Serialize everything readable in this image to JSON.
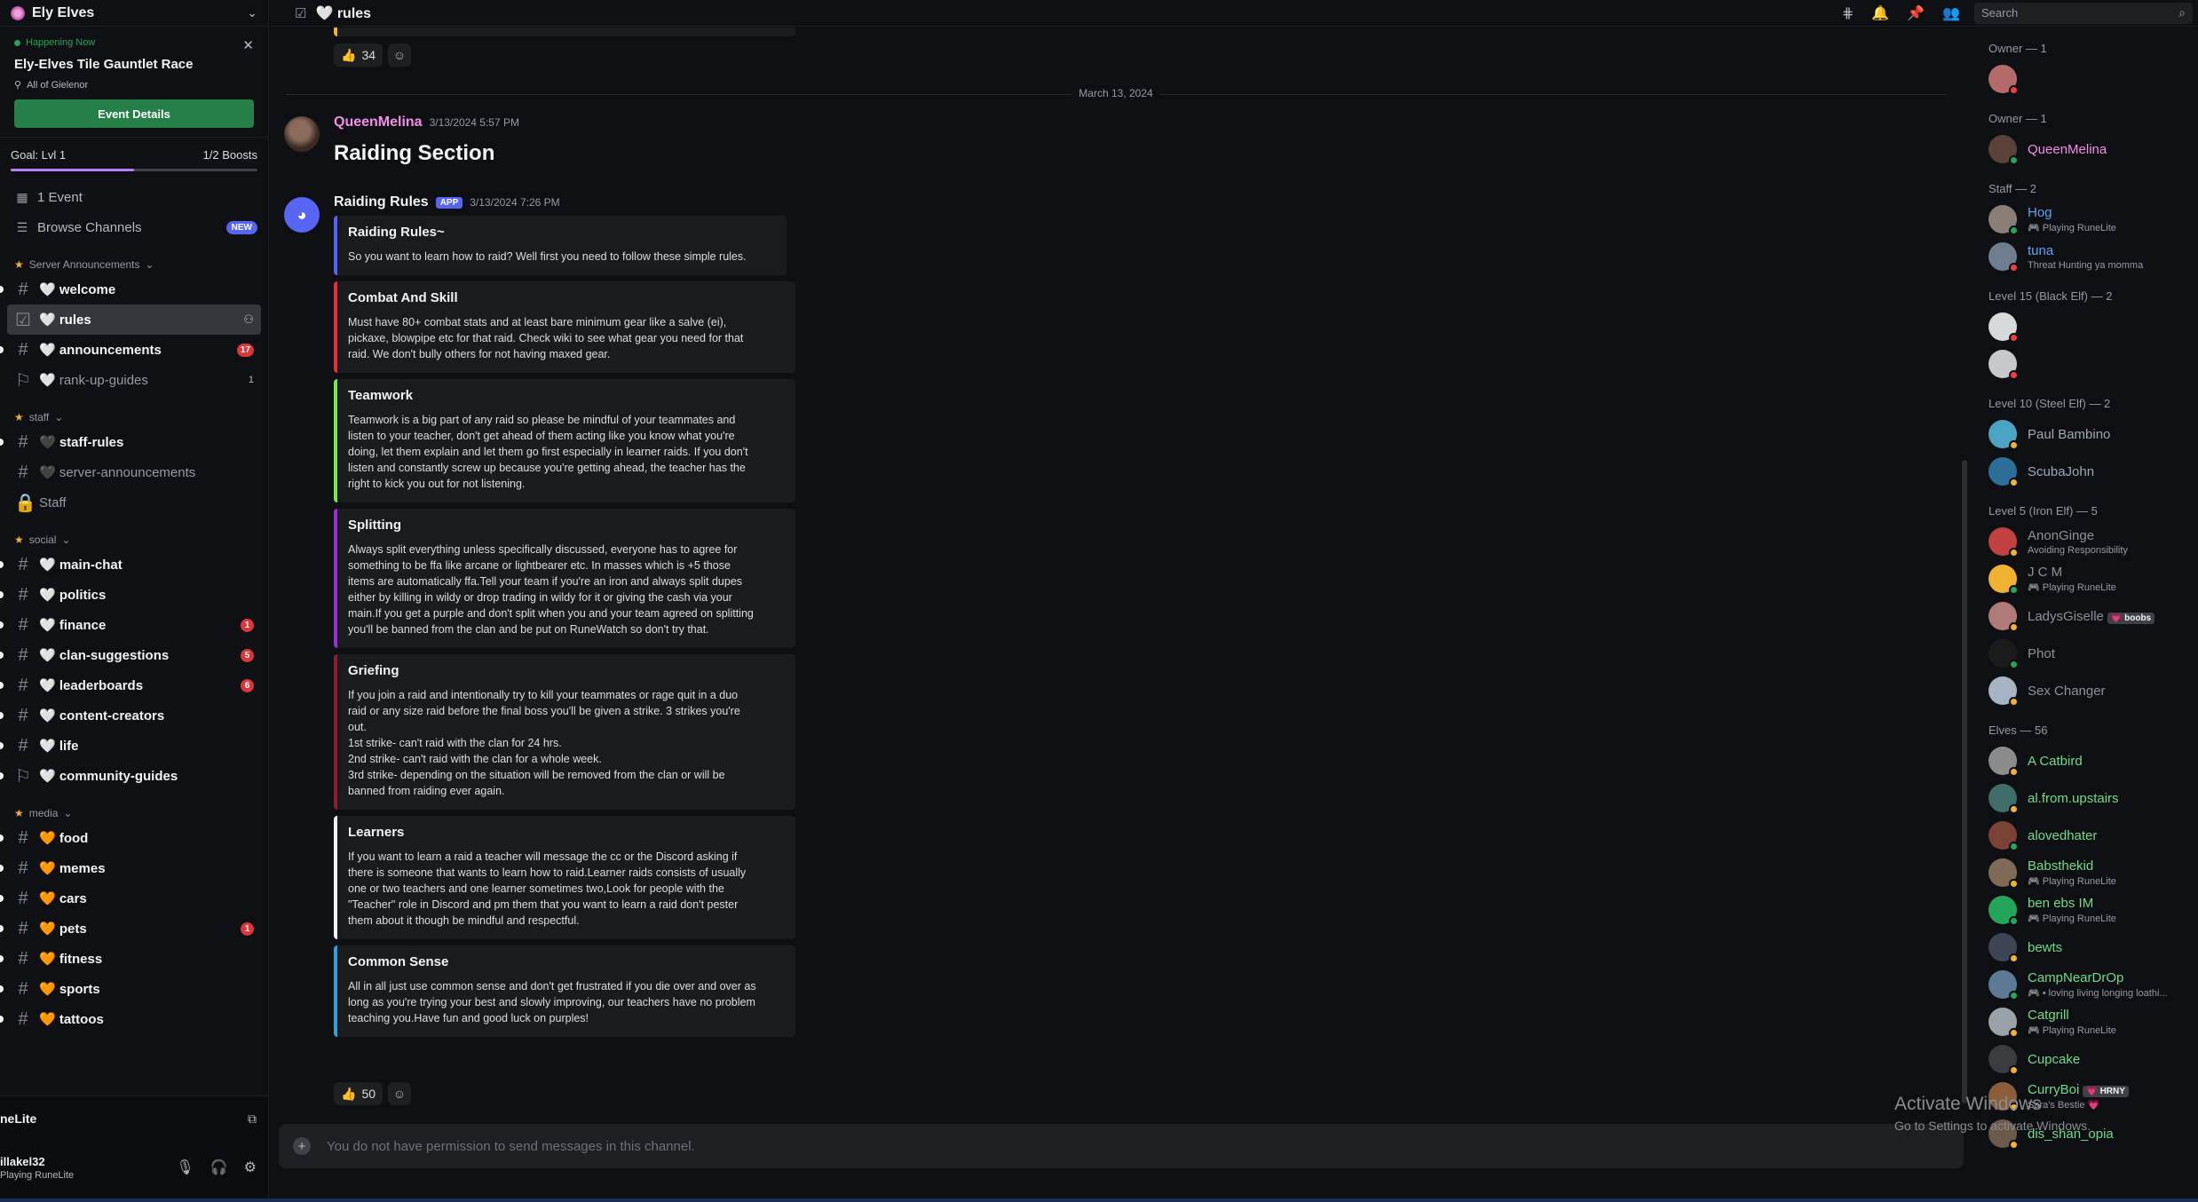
{
  "server": {
    "name": "Ely Elves"
  },
  "event": {
    "status": "Happening Now",
    "title": "Ely-Elves Tile Gauntlet Race",
    "location": "All of Gielenor",
    "button": "Event Details"
  },
  "boost": {
    "goal": "Goal: Lvl 1",
    "progress": "1/2 Boosts",
    "fill_fraction": 0.5
  },
  "nav": {
    "events": "1 Event",
    "browse": "Browse Channels",
    "browse_badge": "NEW"
  },
  "categories": {
    "announcements": "Server Announcements",
    "staff": "staff",
    "social": "social",
    "media": "media"
  },
  "channels": {
    "welcome": "🤍 welcome",
    "rules": "🤍 rules",
    "announcements": "🤍 announcements",
    "announcements_badge": "17",
    "rank_up": "🤍 rank-up-guides",
    "rank_up_count": "1",
    "staff_rules": "🖤 staff-rules",
    "server_ann": "🖤 server-announcements",
    "staff": "Staff",
    "main_chat": "🤍 main-chat",
    "politics": "🤍 politics",
    "finance": "🤍 finance",
    "finance_badge": "1",
    "clan_suggestions": "🤍 clan-suggestions",
    "clan_suggestions_badge": "5",
    "leaderboards": "🤍 leaderboards",
    "leaderboards_badge": "6",
    "content_creators": "🤍 content-creators",
    "life": "🤍 life",
    "community_guides": "🤍 community-guides",
    "food": "🧡 food",
    "memes": "🧡 memes",
    "cars": "🧡 cars",
    "pets": "🧡 pets",
    "pets_badge": "1",
    "fitness": "🧡 fitness",
    "sports": "🧡 sports",
    "tattoos": "🧡 tattoos"
  },
  "user_panel": {
    "activity": "neLite",
    "username": "illakel32",
    "status": "Playing RuneLite"
  },
  "topbar": {
    "channel": "🤍 rules",
    "search_placeholder": "Search"
  },
  "messages": {
    "top_reaction_count": "34",
    "date_divider": "March 13, 2024",
    "msg1": {
      "author": "QueenMelina",
      "time": "3/13/2024 5:57 PM",
      "heading": "Raiding Section"
    },
    "msg2": {
      "author": "Raiding Rules",
      "app_tag": "APP",
      "time": "3/13/2024 7:26 PM",
      "reaction_count": "50"
    }
  },
  "embeds": [
    {
      "title": "Raiding Rules~",
      "color": "#5865f2",
      "desc": "So you want to learn how to raid? Well first you need to follow these simple rules."
    },
    {
      "title": "Combat And Skill",
      "color": "#ed2c3a",
      "desc": "Must have 80+ combat stats and at least bare minimum gear like a salve (ei),\npickaxe, blowpipe etc for that raid. Check wiki to see what gear you need for that\nraid. We don't bully others for not having maxed gear."
    },
    {
      "title": "Teamwork",
      "color": "#7ee84a",
      "desc": "Teamwork is a big part of any raid so please be mindful of your teammates and\nlisten to your teacher, don't get ahead of them acting like you know what you're\ndoing, let them explain and let them go first especially in learner raids. If you don't\nlisten and constantly screw up because you're getting ahead, the teacher has the\nright to kick you out for not listening."
    },
    {
      "title": "Splitting",
      "color": "#9b2fd6",
      "desc": "Always split everything unless specifically discussed, everyone has to agree for\nsomething to be ffa like arcane or lightbearer etc. In masses which is +5 those\nitems are automatically ffa.Tell your team if you're an iron and always split dupes\neither by killing in wildy or drop trading in wildy for it or giving the cash via your\nmain.If you get a purple and don't split when you and your team agreed on splitting\nyou'll be banned from the clan and be put on RuneWatch so don't try that."
    },
    {
      "title": "Griefing",
      "color": "#8c1d2c",
      "desc": "If you join a raid and intentionally try to kill your teammates or rage quit in a duo\nraid or any size raid before the final boss you'll be given a strike. 3 strikes you're\nout.\n1st strike- can't raid with the clan for 24 hrs.\n2nd strike- can't raid with the clan for a whole week.\n3rd strike- depending on the situation will be removed from the clan or will be\nbanned from raiding ever again."
    },
    {
      "title": "Learners",
      "color": "#f2f3f5",
      "desc": "If you want to learn a raid a teacher will message the cc or the Discord asking if\nthere is someone that wants to learn how to raid.Learner raids consists of usually\none or two teachers and one learner sometimes two,Look for people with the\n\"Teacher\" role in Discord and pm them that you want to learn a raid don't pester\nthem about it though be mindful and respectful."
    },
    {
      "title": "Common Sense",
      "color": "#2aa3d9",
      "desc": "All in all just use common sense and don't get frustrated if you die over and over as\nlong as you're trying your best and slowly improving, our teachers have no problem\nteaching you.Have fun and good luck on purples!"
    }
  ],
  "composer": {
    "placeholder": "You do not have permission to send messages in this channel."
  },
  "member_groups": [
    {
      "label": "Owner — 1",
      "members": [
        {
          "name": "",
          "sub": "",
          "color": "#ffffff",
          "status": "dnd",
          "av": "#b56a6a"
        }
      ]
    },
    {
      "label": "Owner — 1",
      "members": [
        {
          "name": "QueenMelina",
          "sub": "",
          "color": "#f28fe6",
          "status": "online",
          "av": "#5a4238"
        }
      ]
    },
    {
      "label": "Staff — 2",
      "members": [
        {
          "name": "Hog",
          "sub": "🎮 Playing RuneLite",
          "color": "#5da3f5",
          "status": "online",
          "av": "#8a7e77"
        },
        {
          "name": "tuna",
          "sub": "Threat Hunting ya momma",
          "color": "#5da3f5",
          "status": "dnd",
          "av": "#6d7e8f"
        }
      ]
    },
    {
      "label": "Level 15 (Black Elf) — 2",
      "members": [
        {
          "name": "",
          "sub": "",
          "color": "#ffffff",
          "status": "dnd",
          "av": "#d8d9dc"
        },
        {
          "name": "",
          "sub": "",
          "color": "#ffffff",
          "status": "dnd",
          "av": "#c7c8cc"
        }
      ]
    },
    {
      "label": "Level 10 (Steel Elf) — 2",
      "members": [
        {
          "name": "Paul Bambino",
          "sub": "",
          "color": "#9ea9b3",
          "status": "idle",
          "av": "#4da3c2"
        },
        {
          "name": "ScubaJohn",
          "sub": "",
          "color": "#9ea9b3",
          "status": "idle",
          "av": "#2b6f98"
        }
      ]
    },
    {
      "label": "Level 5 (Iron Elf) — 5",
      "members": [
        {
          "name": "AnonGinge",
          "sub": "Avoiding Responsibility",
          "color": "#8e9297",
          "status": "idle",
          "av": "#c14040"
        },
        {
          "name": "J C M",
          "sub": "🎮 Playing RuneLite",
          "color": "#8e9297",
          "status": "online",
          "av": "#f0b232"
        },
        {
          "name": "LadysGiselle",
          "sub": "",
          "color": "#8e9297",
          "status": "idle",
          "av": "#b07a78",
          "tag": "💗 boobs"
        },
        {
          "name": "Phot",
          "sub": "",
          "color": "#8e9297",
          "status": "online",
          "av": "#1b1b1b"
        },
        {
          "name": "Sex Changer",
          "sub": "",
          "color": "#8e9297",
          "status": "idle",
          "av": "#a7b4c4"
        }
      ]
    },
    {
      "label": "Elves — 56",
      "members": [
        {
          "name": "A Catbird",
          "sub": "",
          "color": "#6fdc8c",
          "status": "idle",
          "av": "#8b8b8b"
        },
        {
          "name": "al.from.upstairs",
          "sub": "",
          "color": "#6fdc8c",
          "status": "idle",
          "av": "#3f6d6a"
        },
        {
          "name": "alovedhater",
          "sub": "",
          "color": "#6fdc8c",
          "status": "online",
          "av": "#7a4135"
        },
        {
          "name": "Babsthekid",
          "sub": "🎮 Playing RuneLite",
          "color": "#6fdc8c",
          "status": "idle",
          "av": "#7e6a55"
        },
        {
          "name": "ben ebs IM",
          "sub": "🎮 Playing RuneLite",
          "color": "#6fdc8c",
          "status": "online",
          "av": "#23a55a"
        },
        {
          "name": "bewts",
          "sub": "",
          "color": "#6fdc8c",
          "status": "idle",
          "av": "#3d4552"
        },
        {
          "name": "CampNearDrOp",
          "sub": "🎮 • loving living longing loathi...",
          "color": "#6fdc8c",
          "status": "online",
          "av": "#5c7a94"
        },
        {
          "name": "Catgrill",
          "sub": "🎮 Playing RuneLite",
          "color": "#6fdc8c",
          "status": "idle",
          "av": "#9aa1a8"
        },
        {
          "name": "Cupcake",
          "sub": "",
          "color": "#6fdc8c",
          "status": "idle",
          "av": "#3a3c40"
        },
        {
          "name": "CurryBoi",
          "sub": "Sara's Bestie 💗",
          "color": "#6fdc8c",
          "status": "idle",
          "av": "#8a5d3b",
          "tag": "💗 HRNY"
        },
        {
          "name": "dis_shan_opia",
          "sub": "",
          "color": "#6fdc8c",
          "status": "idle",
          "av": "#6b5a4c"
        }
      ]
    }
  ],
  "watermark": {
    "title": "Activate Windows",
    "sub": "Go to Settings to activate Windows."
  }
}
